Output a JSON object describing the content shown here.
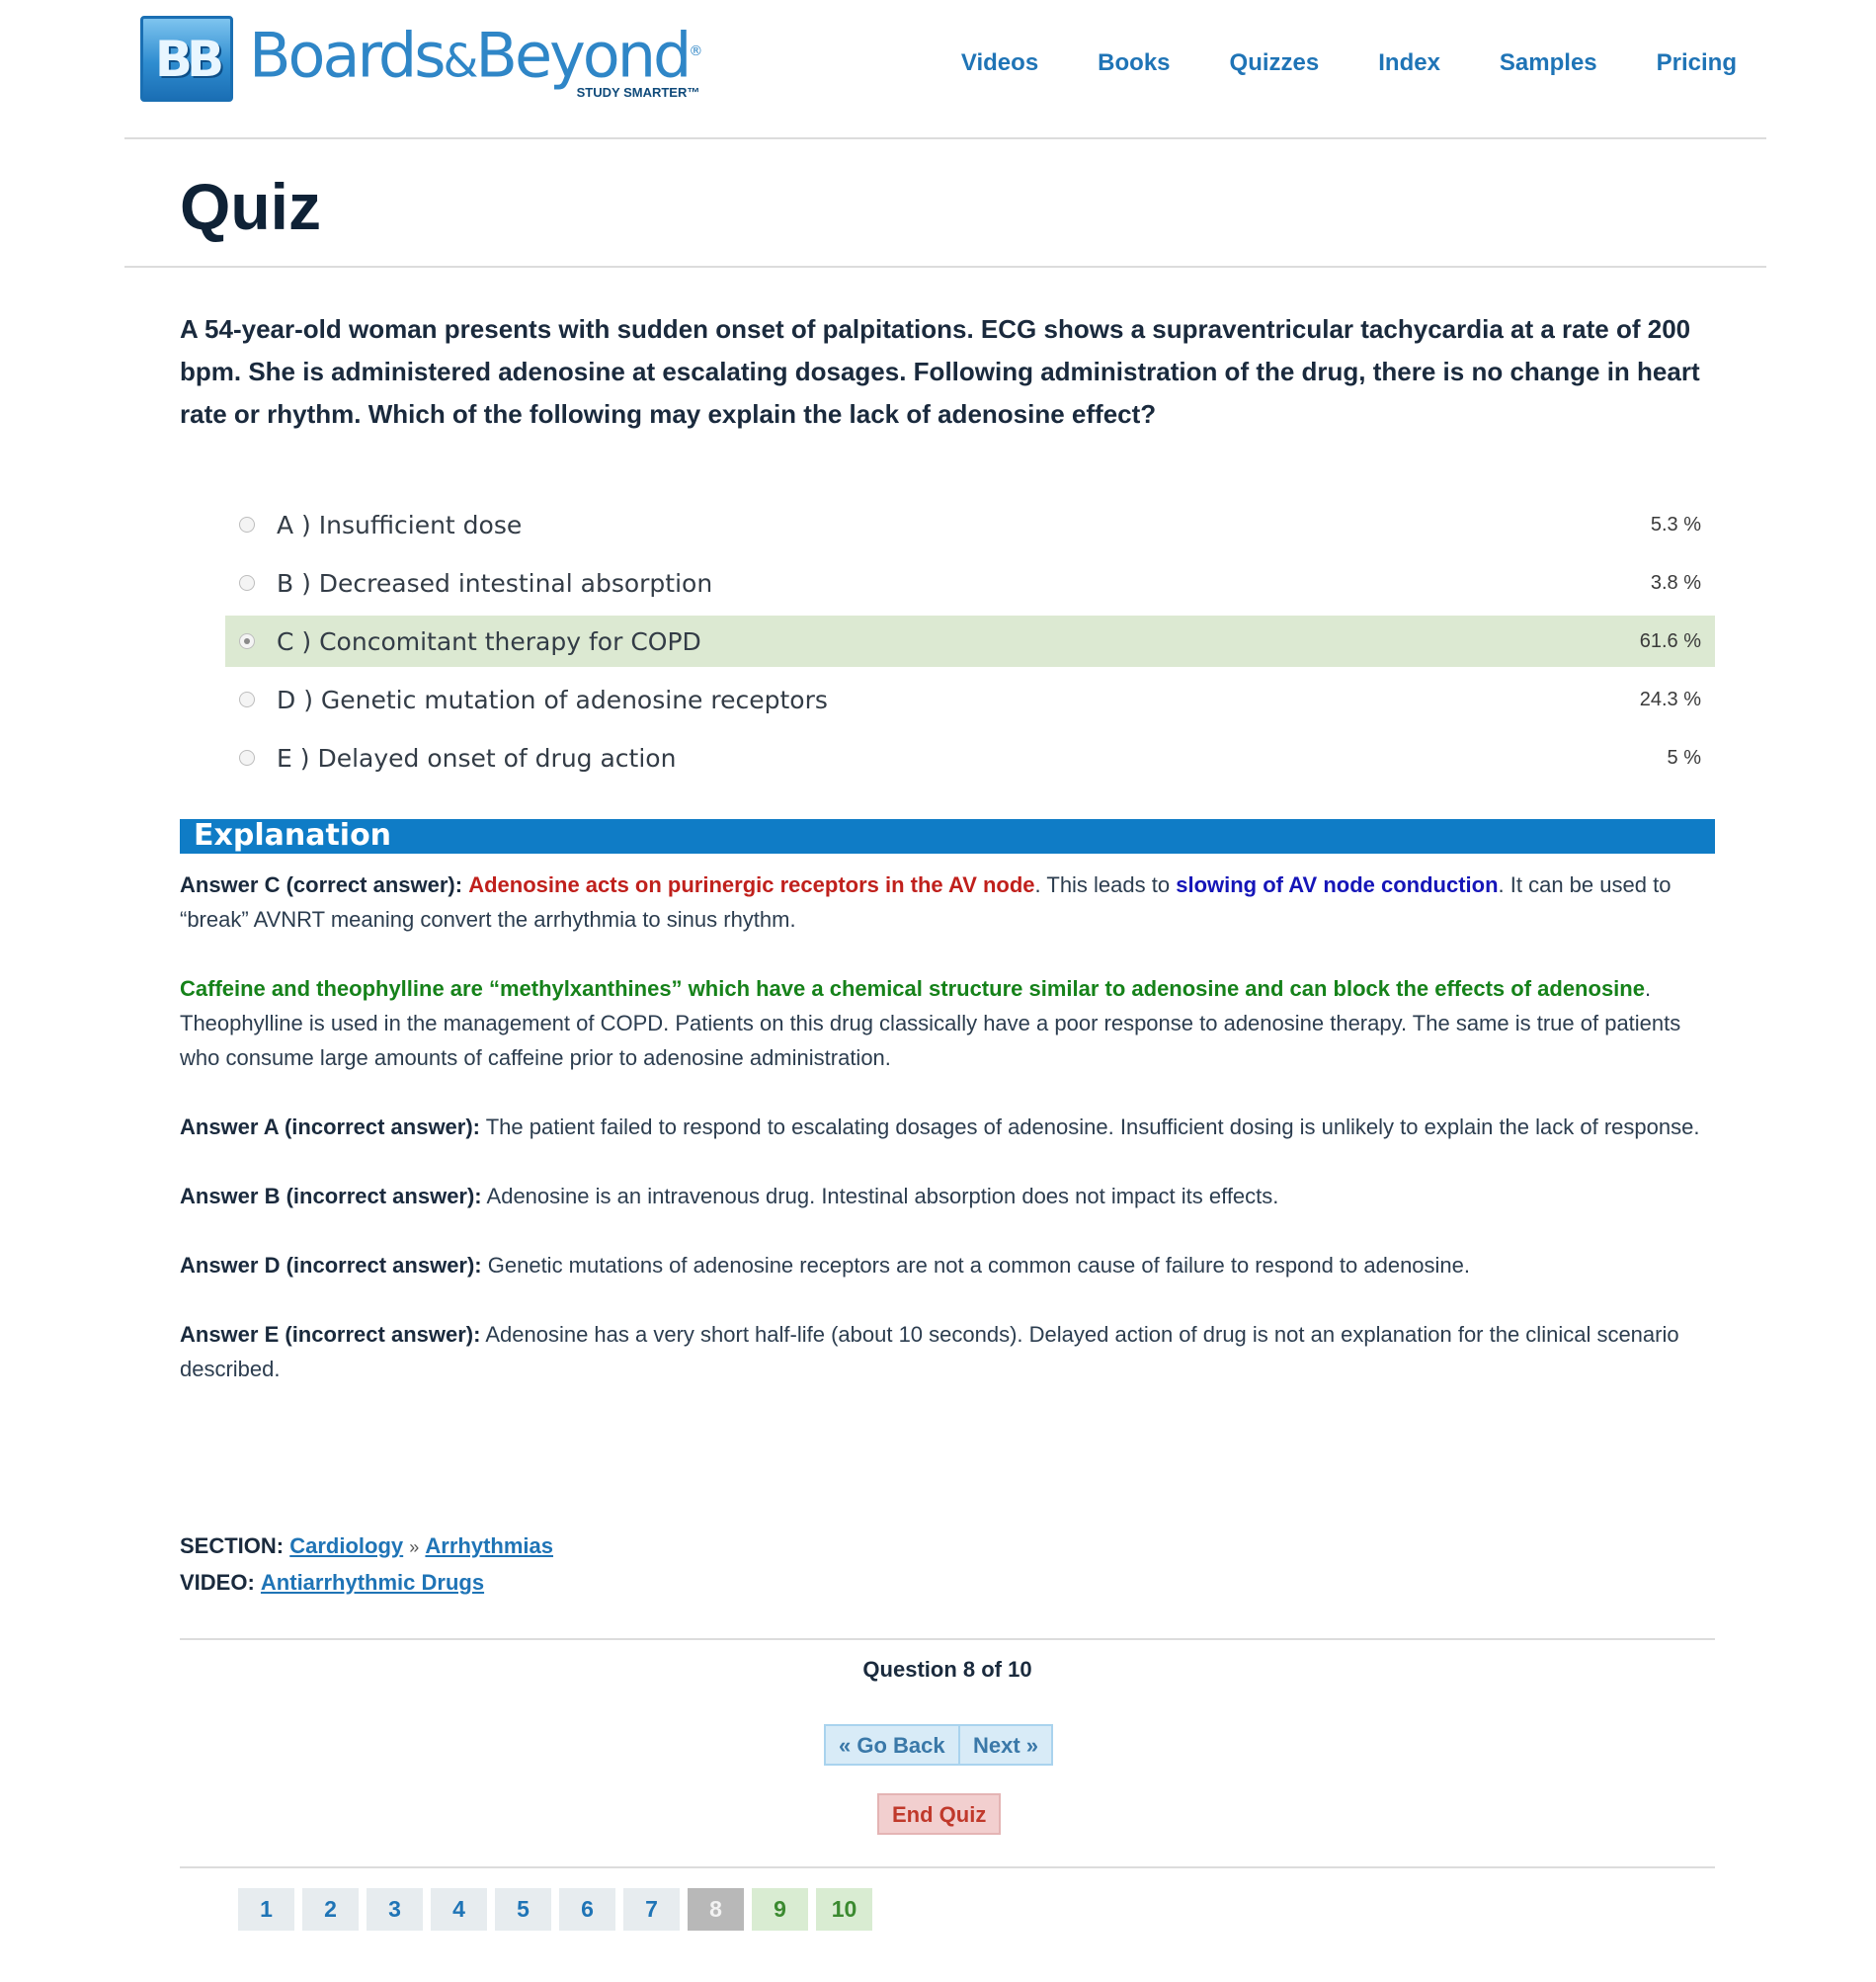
{
  "header": {
    "logo_mark": "BB",
    "logo_name_1": "Boards",
    "logo_amp": "&",
    "logo_name_2": "Beyond",
    "logo_tagline": "STUDY SMARTER™",
    "logo_registered": "®",
    "nav": [
      "Videos",
      "Books",
      "Quizzes",
      "Index",
      "Samples",
      "Pricing"
    ]
  },
  "page_title": "Quiz",
  "question": "A 54-year-old woman presents with sudden onset of palpitations. ECG shows a supraventricular tachycardia at a rate of 200 bpm.  She is administered adenosine at escalating dosages. Following administration of the drug, there is no change in heart rate or rhythm. Which of the following may explain the lack of adenosine effect?",
  "answers": [
    {
      "label": "A ) Insufficient dose",
      "percent": "5.3 %",
      "selected": false
    },
    {
      "label": "B ) Decreased intestinal absorption",
      "percent": "3.8 %",
      "selected": false
    },
    {
      "label": "C ) Concomitant therapy for COPD",
      "percent": "61.6 %",
      "selected": true
    },
    {
      "label": "D ) Genetic mutation of adenosine receptors",
      "percent": "24.3 %",
      "selected": false
    },
    {
      "label": "E ) Delayed onset of drug action",
      "percent": "5 %",
      "selected": false
    }
  ],
  "explanation": {
    "heading": "Explanation",
    "c_lead": "Answer C (correct answer):",
    "c_red": "Adenosine acts on purinergic receptors in the AV node",
    "c_mid": ". This leads to ",
    "c_blue": "slowing of AV node conduction",
    "c_tail": ". It can be used to “break” AVNRT meaning convert the arrhythmia to sinus rhythm.",
    "green": "Caffeine and theophylline are “methylxanthines” which have a chemical structure similar to adenosine and can block the effects of adenosine",
    "green_tail": ". Theophylline is used in the management of COPD. Patients on this drug classically have a poor response to adenosine therapy.  The same is true of patients who consume large amounts of caffeine prior to adenosine administration.",
    "a_lead": "Answer A (incorrect answer):",
    "a_text": " The patient failed to respond to escalating dosages of adenosine. Insufficient dosing is unlikely to explain the lack of response.",
    "b_lead": "Answer B (incorrect answer):",
    "b_text": " Adenosine is an intravenous drug. Intestinal absorption does not impact its effects.",
    "d_lead": "Answer D (incorrect answer):",
    "d_text": " Genetic mutations of adenosine receptors are not a common cause of failure to respond to adenosine.",
    "e_lead": "Answer E (incorrect answer):",
    "e_text": " Adenosine has a very short half-life (about 10 seconds). Delayed action of drug is not an explanation for the clinical scenario described."
  },
  "meta": {
    "section_label": "SECTION:",
    "section_link_1": "Cardiology",
    "separator": "»",
    "section_link_2": "Arrhythmias",
    "video_label": "VIDEO:",
    "video_link": "Antiarrhythmic Drugs"
  },
  "question_count": "Question 8 of 10",
  "buttons": {
    "back": "« Go Back",
    "next": "Next »",
    "end": "End Quiz"
  },
  "pager": [
    "1",
    "2",
    "3",
    "4",
    "5",
    "6",
    "7",
    "8",
    "9",
    "10"
  ],
  "colors": {
    "brand_blue": "#1f74b6",
    "explanation_bar": "#0f7cc6",
    "selected_answer_bg": "#dce9d2"
  }
}
